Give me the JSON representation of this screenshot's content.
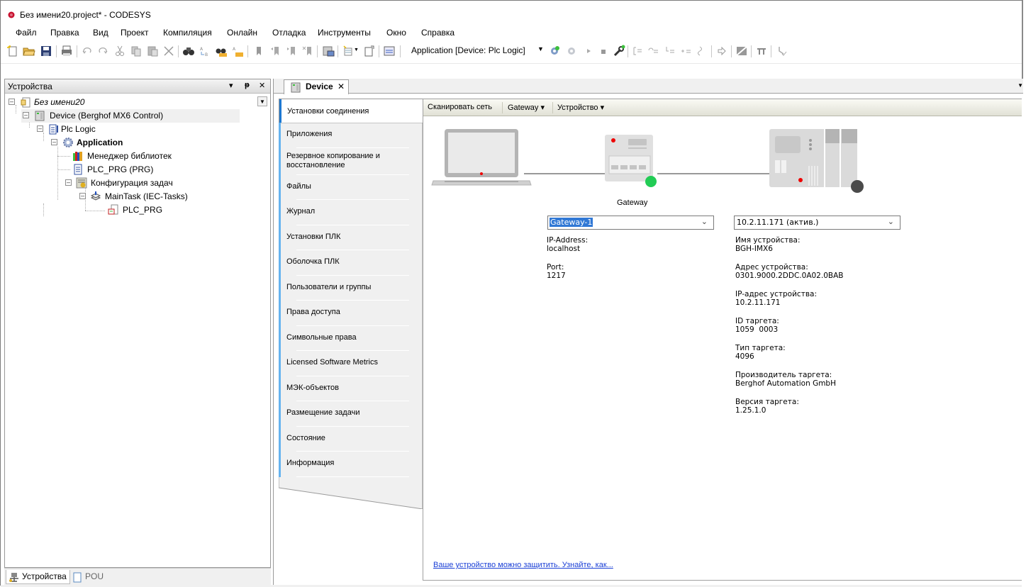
{
  "window": {
    "title": "Без имени20.project* - CODESYS",
    "app_icon": "codesys-logo-icon"
  },
  "menu": [
    "Файл",
    "Правка",
    "Вид",
    "Проект",
    "Компиляция",
    "Онлайн",
    "Отладка",
    "Инструменты",
    "Окно",
    "Справка"
  ],
  "toolbar": {
    "active_application": "Application [Device: Plc Logic]",
    "icons": [
      "new-project-icon",
      "open-folder-icon",
      "save-icon",
      "print-icon",
      "undo-icon",
      "redo-icon",
      "cut-icon",
      "copy-icon",
      "paste-icon",
      "delete-icon",
      "find-icon",
      "replace-icon",
      "find-in-project-icon",
      "replace-in-project-icon",
      "bookmark-icon",
      "prev-bookmark-icon",
      "next-bookmark-icon",
      "clear-bookmarks-icon",
      "device-config-icon",
      "add-object-icon",
      "object-properties-icon",
      "visualization-icon",
      "login-icon",
      "logout-icon",
      "start-icon",
      "stop-icon",
      "reset-tool-icon",
      "breakpoint-icon",
      "step-over-icon",
      "step-into-icon",
      "step-out-icon",
      "run-to-cursor-icon",
      "show-next-statement-icon",
      "force-values-icon",
      "write-values-icon",
      "release-force-icon"
    ]
  },
  "devices_pane": {
    "title": "Устройства",
    "buttons": {
      "dropdown": "▾",
      "pin": "ᵽ",
      "close": "✕"
    },
    "tree": [
      {
        "label": "Без имени20",
        "level": 0,
        "icon": "project-icon",
        "italic": true,
        "expanded": true
      },
      {
        "label": "Device (Berghof MX6 Control)",
        "level": 1,
        "icon": "device-icon",
        "expanded": true,
        "highlighted": true
      },
      {
        "label": "Plc Logic",
        "level": 2,
        "icon": "plc-logic-icon",
        "expanded": true
      },
      {
        "label": "Application",
        "level": 3,
        "icon": "application-gear-icon",
        "bold": true,
        "expanded": true
      },
      {
        "label": "Менеджер библиотек",
        "level": 4,
        "icon": "library-manager-icon"
      },
      {
        "label": "PLC_PRG (PRG)",
        "level": 4,
        "icon": "program-icon"
      },
      {
        "label": "Конфигурация задач",
        "level": 4,
        "icon": "task-config-icon",
        "expanded": true
      },
      {
        "label": "MainTask (IEC-Tasks)",
        "level": 5,
        "icon": "task-icon",
        "expanded": true
      },
      {
        "label": "PLC_PRG",
        "level": 6,
        "icon": "program-call-icon"
      }
    ],
    "bottom_tabs": [
      {
        "label": "Устройства",
        "icon": "devices-tab-icon",
        "active": true
      },
      {
        "label": "POU",
        "icon": "pou-tab-icon",
        "active": false
      }
    ]
  },
  "editor": {
    "tab": {
      "label": "Device",
      "close": "✕",
      "icon": "device-icon"
    },
    "side_tabs": [
      {
        "label": "Установки соединения",
        "active": true
      },
      {
        "label": "Приложения"
      },
      {
        "label": "Резервное копирование и восстановление"
      },
      {
        "label": "Файлы"
      },
      {
        "label": "Журнал"
      },
      {
        "label": "Установки ПЛК"
      },
      {
        "label": "Оболочка ПЛК"
      },
      {
        "label": "Пользователи и группы"
      },
      {
        "label": "Права доступа"
      },
      {
        "label": "Символьные права"
      },
      {
        "label": "Licensed Software Metrics"
      },
      {
        "label": "МЭК-объектов"
      },
      {
        "label": "Размещение задачи"
      },
      {
        "label": "Состояние"
      },
      {
        "label": "Информация"
      }
    ],
    "content_toolbar": [
      {
        "label": "Сканировать сеть",
        "dropdown": false
      },
      {
        "label": "Gateway ▾",
        "dropdown": true
      },
      {
        "label": "Устройство ▾",
        "dropdown": true
      }
    ],
    "gateway": {
      "caption": "Gateway",
      "status_color": "#22cc55",
      "selected": "Gateway-1",
      "fields": [
        {
          "label": "IP-Address:",
          "value": "localhost"
        },
        {
          "label": "Port:",
          "value": "1217"
        }
      ]
    },
    "device": {
      "status_color": "#4a4a4a",
      "selected": "10.2.11.171 (актив.)",
      "fields": [
        {
          "label": "Имя устройства:",
          "value": "BGH-IMX6"
        },
        {
          "label": "Адрес устройства:",
          "value": "0301.9000.2DDC.0A02.0BAB"
        },
        {
          "label": "IP-адрес устройства:",
          "value": "10.2.11.171"
        },
        {
          "label": "ID таргета:",
          "value": "1059  0003"
        },
        {
          "label": "Тип таргета:",
          "value": "4096"
        },
        {
          "label": "Производитель таргета:",
          "value": "Berghof Automation GmbH"
        },
        {
          "label": "Версия таргета:",
          "value": "1.25.1.0"
        }
      ]
    },
    "protect_link": "Ваше устройство можно защитить. Узнайте, как...",
    "chevron": "⌄"
  },
  "colors": {
    "accent_blue": "#1e78d0",
    "tab_bar": "#66b3ef",
    "link": "#1a3fd6",
    "selection": "#3078d5"
  }
}
